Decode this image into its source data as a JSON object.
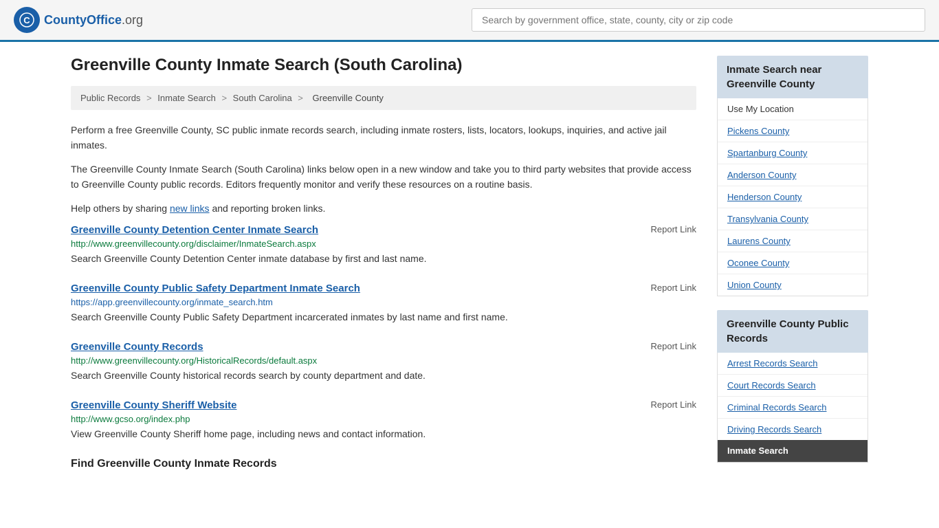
{
  "header": {
    "logo_icon": "🔵",
    "logo_name": "CountyOffice",
    "logo_suffix": ".org",
    "search_placeholder": "Search by government office, state, county, city or zip code"
  },
  "page": {
    "title": "Greenville County Inmate Search (South Carolina)"
  },
  "breadcrumb": {
    "items": [
      "Public Records",
      "Inmate Search",
      "South Carolina",
      "Greenville County"
    ]
  },
  "intro": {
    "para1": "Perform a free Greenville County, SC public inmate records search, including inmate rosters, lists, locators, lookups, inquiries, and active jail inmates.",
    "para2": "The Greenville County Inmate Search (South Carolina) links below open in a new window and take you to third party websites that provide access to Greenville County public records. Editors frequently monitor and verify these resources on a routine basis.",
    "para3_prefix": "Help others by sharing ",
    "para3_link": "new links",
    "para3_suffix": " and reporting broken links."
  },
  "results": [
    {
      "title": "Greenville County Detention Center Inmate Search",
      "report": "Report Link",
      "url": "http://www.greenvillecounty.org/disclaimer/InmateSearch.aspx",
      "url_color": "green",
      "description": "Search Greenville County Detention Center inmate database by first and last name."
    },
    {
      "title": "Greenville County Public Safety Department Inmate Search",
      "report": "Report Link",
      "url": "https://app.greenvillecounty.org/inmate_search.htm",
      "url_color": "blue",
      "description": "Search Greenville County Public Safety Department incarcerated inmates by last name and first name."
    },
    {
      "title": "Greenville County Records",
      "report": "Report Link",
      "url": "http://www.greenvillecounty.org/HistoricalRecords/default.aspx",
      "url_color": "green",
      "description": "Search Greenville County historical records search by county department and date."
    },
    {
      "title": "Greenville County Sheriff Website",
      "report": "Report Link",
      "url": "http://www.gcso.org/index.php",
      "url_color": "green",
      "description": "View Greenville County Sheriff home page, including news and contact information."
    }
  ],
  "bottom_section_title": "Find Greenville County Inmate Records",
  "sidebar": {
    "nearby_header": "Inmate Search near Greenville County",
    "use_my_location": "Use My Location",
    "nearby_counties": [
      "Pickens County",
      "Spartanburg County",
      "Anderson County",
      "Henderson County",
      "Transylvania County",
      "Laurens County",
      "Oconee County",
      "Union County"
    ],
    "public_records_header": "Greenville County Public Records",
    "public_records_links": [
      "Arrest Records Search",
      "Court Records Search",
      "Criminal Records Search",
      "Driving Records Search"
    ],
    "active_link": "Inmate Search"
  }
}
